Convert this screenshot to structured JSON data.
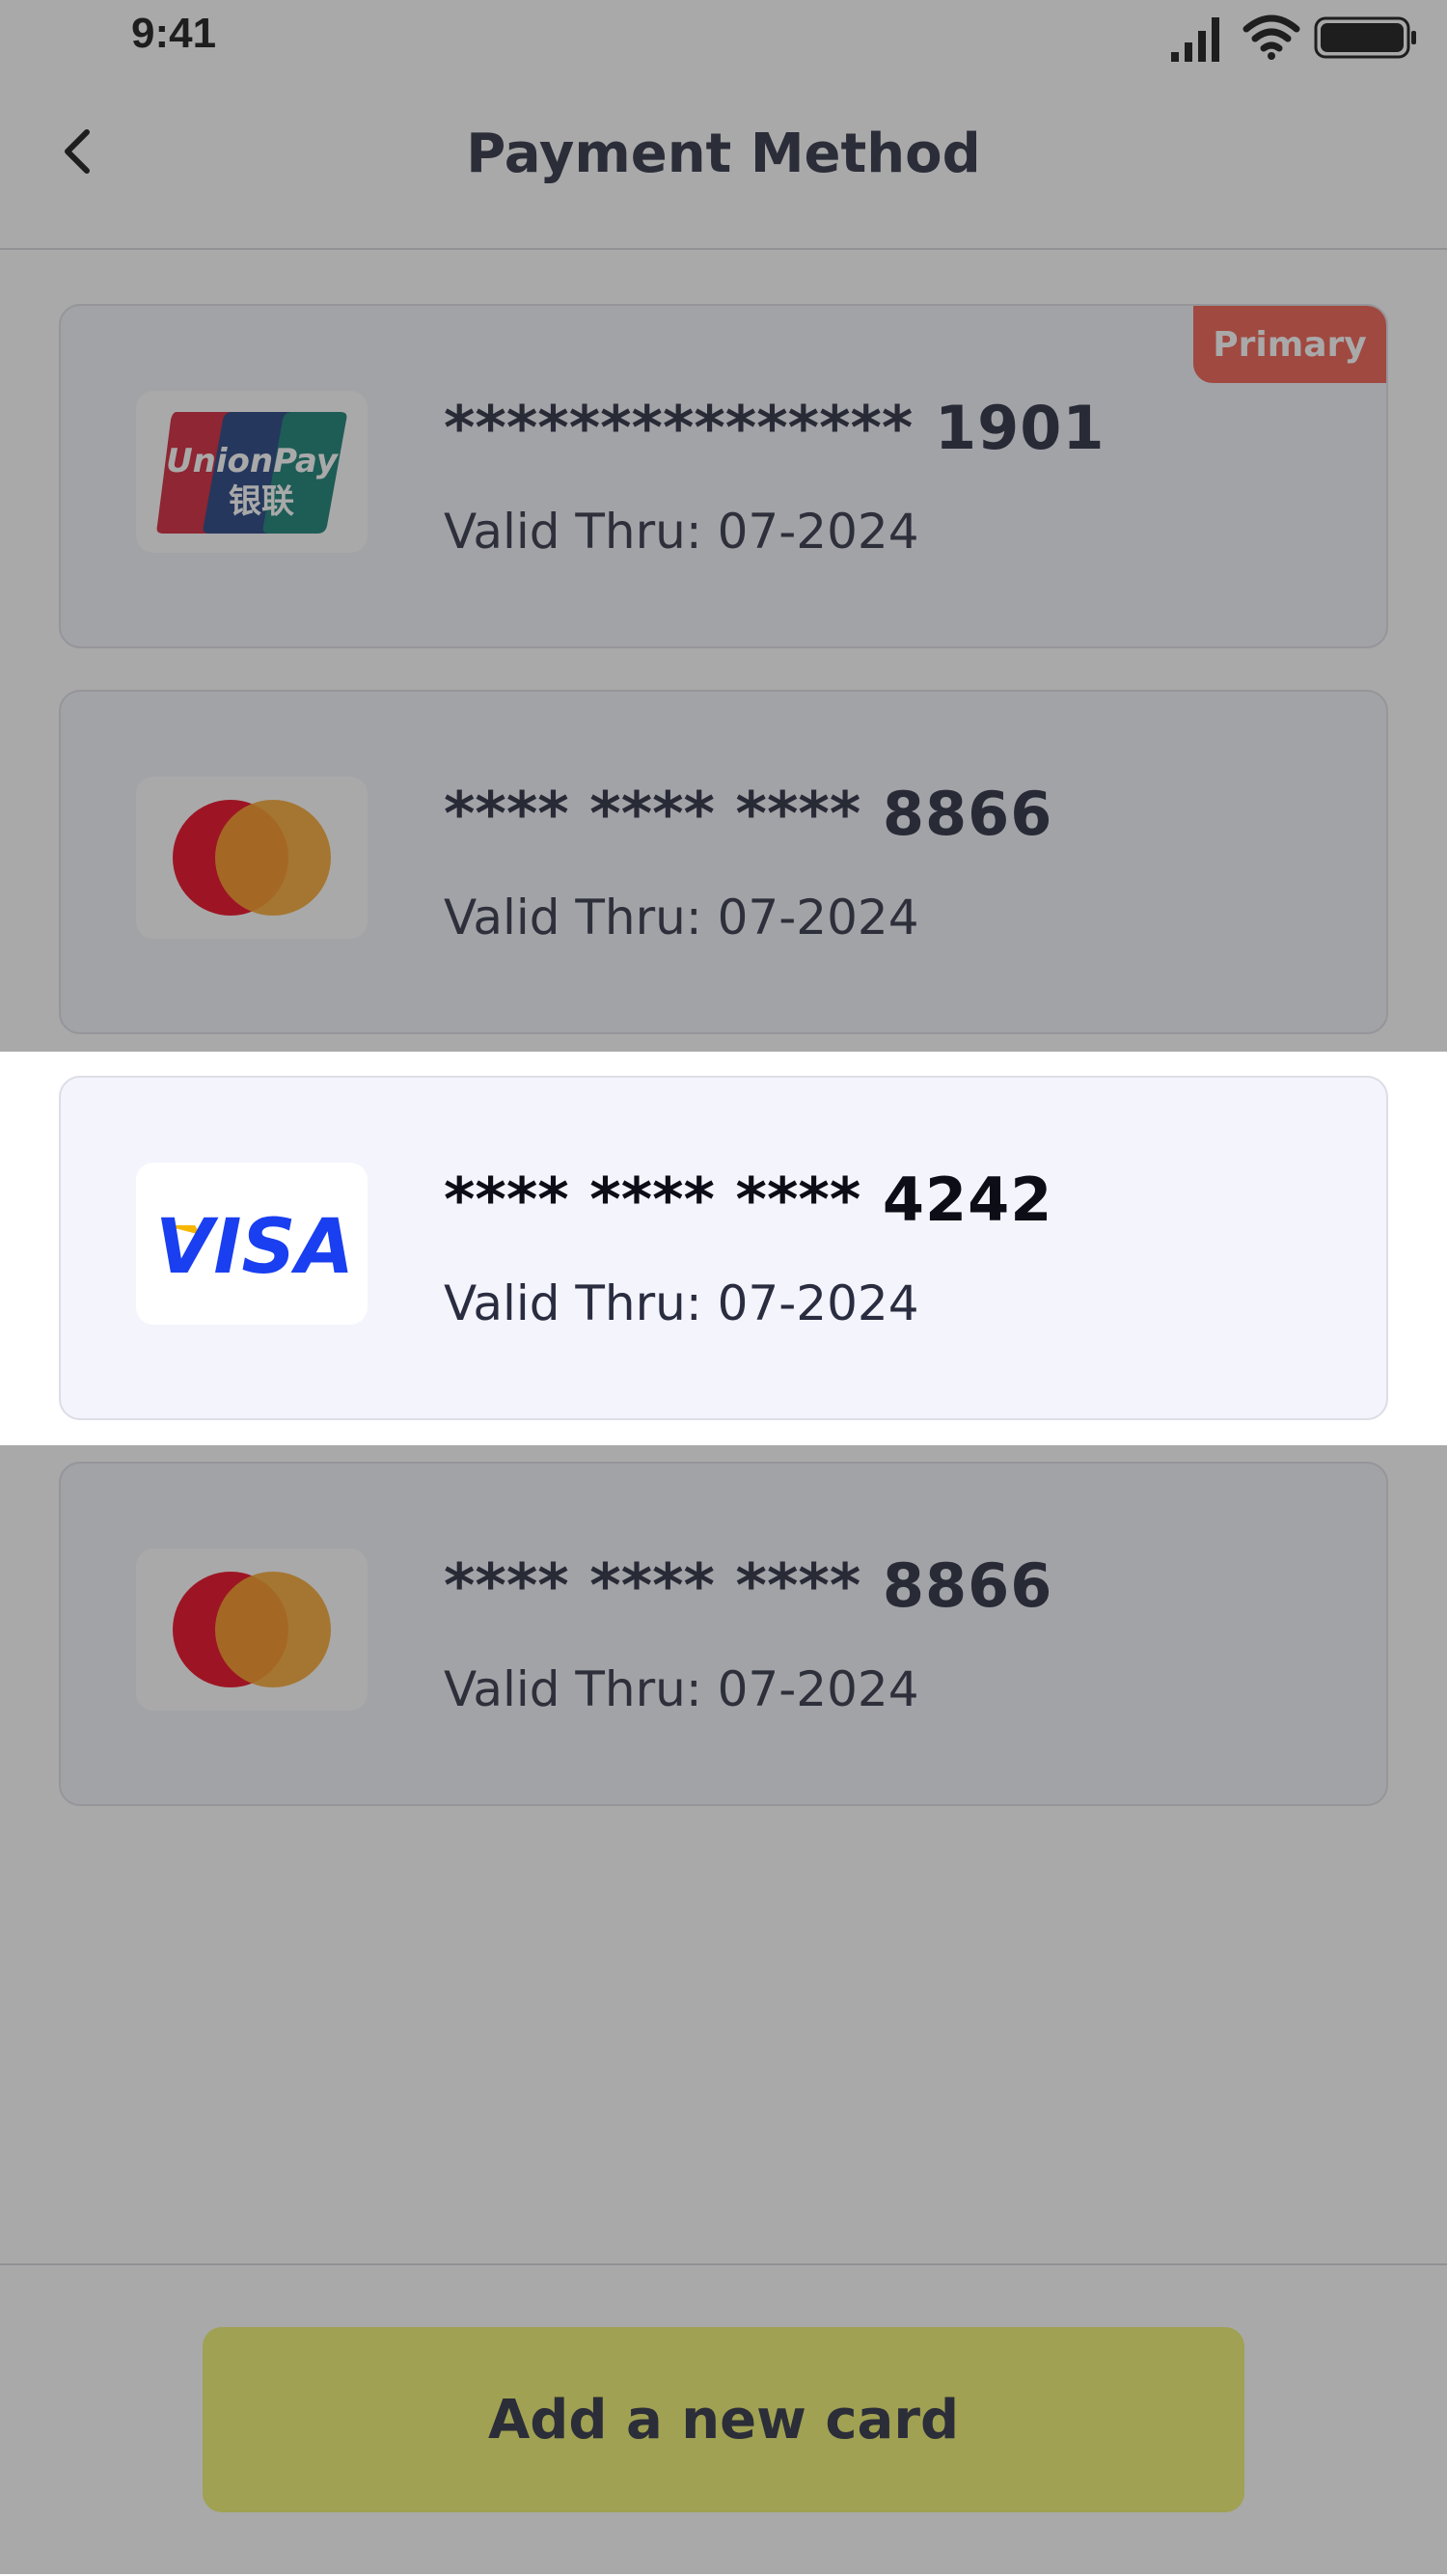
{
  "status_bar": {
    "time": "9:41",
    "icons": [
      "signal-icon",
      "wifi-icon",
      "battery-icon"
    ]
  },
  "header": {
    "title": "Payment Method",
    "back_icon": "chevron-left-icon"
  },
  "cards": [
    {
      "brand": "UnionPay",
      "brand_text": "UnionPay",
      "brand_subtext": "银联",
      "mask": "***************",
      "last4": "1901",
      "valid": "Valid Thru: 07-2024",
      "badge": "Primary"
    },
    {
      "brand": "Mastercard",
      "mask": "**** **** ****",
      "last4": "8866",
      "valid": "Valid Thru: 07-2024"
    },
    {
      "brand": "Visa",
      "brand_text": "VISA",
      "mask": "**** **** ****",
      "last4": "4242",
      "valid": "Valid Thru: 07-2024",
      "selected": true
    },
    {
      "brand": "Mastercard",
      "mask": "**** **** ****",
      "last4": "8866",
      "valid": "Valid Thru: 07-2024"
    }
  ],
  "footer": {
    "add_card_label": "Add a new card"
  },
  "colors": {
    "accent": "#F0F16A",
    "badge": "#EF5A4A",
    "card_bg": "#F3F4FC",
    "text": "#272A3D",
    "visa_blue": "#1A3FF0"
  }
}
